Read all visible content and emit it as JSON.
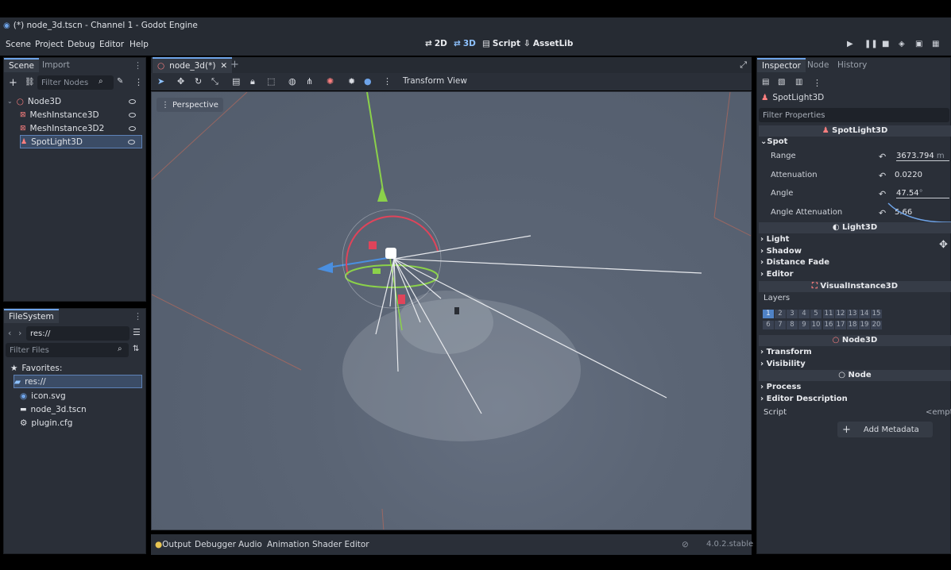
{
  "window": {
    "title": "(*) node_3d.tscn - Channel 1 - Godot Engine"
  },
  "menu": [
    "Scene",
    "Project",
    "Debug",
    "Editor",
    "Help"
  ],
  "workspaces": {
    "w2d": "2D",
    "w3d": "3D",
    "script": "Script",
    "assetlib": "AssetLib"
  },
  "scene_dock": {
    "tab_scene": "Scene",
    "tab_import": "Import",
    "filter_placeholder": "Filter Nodes",
    "nodes": [
      "Node3D",
      "MeshInstance3D",
      "MeshInstance3D2",
      "SpotLight3D"
    ]
  },
  "filesystem": {
    "tab": "FileSystem",
    "path": "res://",
    "filter_placeholder": "Filter Files",
    "favorites": "Favorites:",
    "root": "res://",
    "files": [
      "icon.svg",
      "node_3d.tscn",
      "plugin.cfg"
    ]
  },
  "viewport": {
    "tab_label": "node_3d(*)",
    "transform": "Transform",
    "view": "View",
    "perspective": "Perspective"
  },
  "bottom": {
    "output": "Output",
    "debugger": "Debugger",
    "audio": "Audio",
    "animation": "Animation",
    "shader_editor": "Shader Editor",
    "version": "4.0.2.stable"
  },
  "inspector": {
    "tab_inspector": "Inspector",
    "tab_node": "Node",
    "tab_history": "History",
    "object": "SpotLight3D",
    "filter": "Filter Properties",
    "class_spot": "SpotLight3D",
    "group_spot": "Spot",
    "props": [
      {
        "label": "Range",
        "value": "3673.794",
        "unit": "m"
      },
      {
        "label": "Attenuation",
        "value": "0.0220",
        "unit": ""
      },
      {
        "label": "Angle",
        "value": "47.54",
        "unit": "°"
      },
      {
        "label": "Angle Attenuation",
        "value": "5.66",
        "unit": ""
      }
    ],
    "class_light": "Light3D",
    "light_groups": [
      "Light",
      "Shadow",
      "Distance Fade",
      "Editor"
    ],
    "class_visual": "VisualInstance3D",
    "layers_label": "Layers",
    "layers": [
      "1",
      "2",
      "3",
      "4",
      "5",
      "11",
      "12",
      "13",
      "14",
      "15",
      "6",
      "7",
      "8",
      "9",
      "10",
      "16",
      "17",
      "18",
      "19",
      "20"
    ],
    "class_node3d": "Node3D",
    "node3d_groups": [
      "Transform",
      "Visibility"
    ],
    "class_node": "Node",
    "node_groups": [
      "Process",
      "Editor Description"
    ],
    "script_label": "Script",
    "script_value": "<empty>",
    "add_metadata": "Add Metadata"
  }
}
